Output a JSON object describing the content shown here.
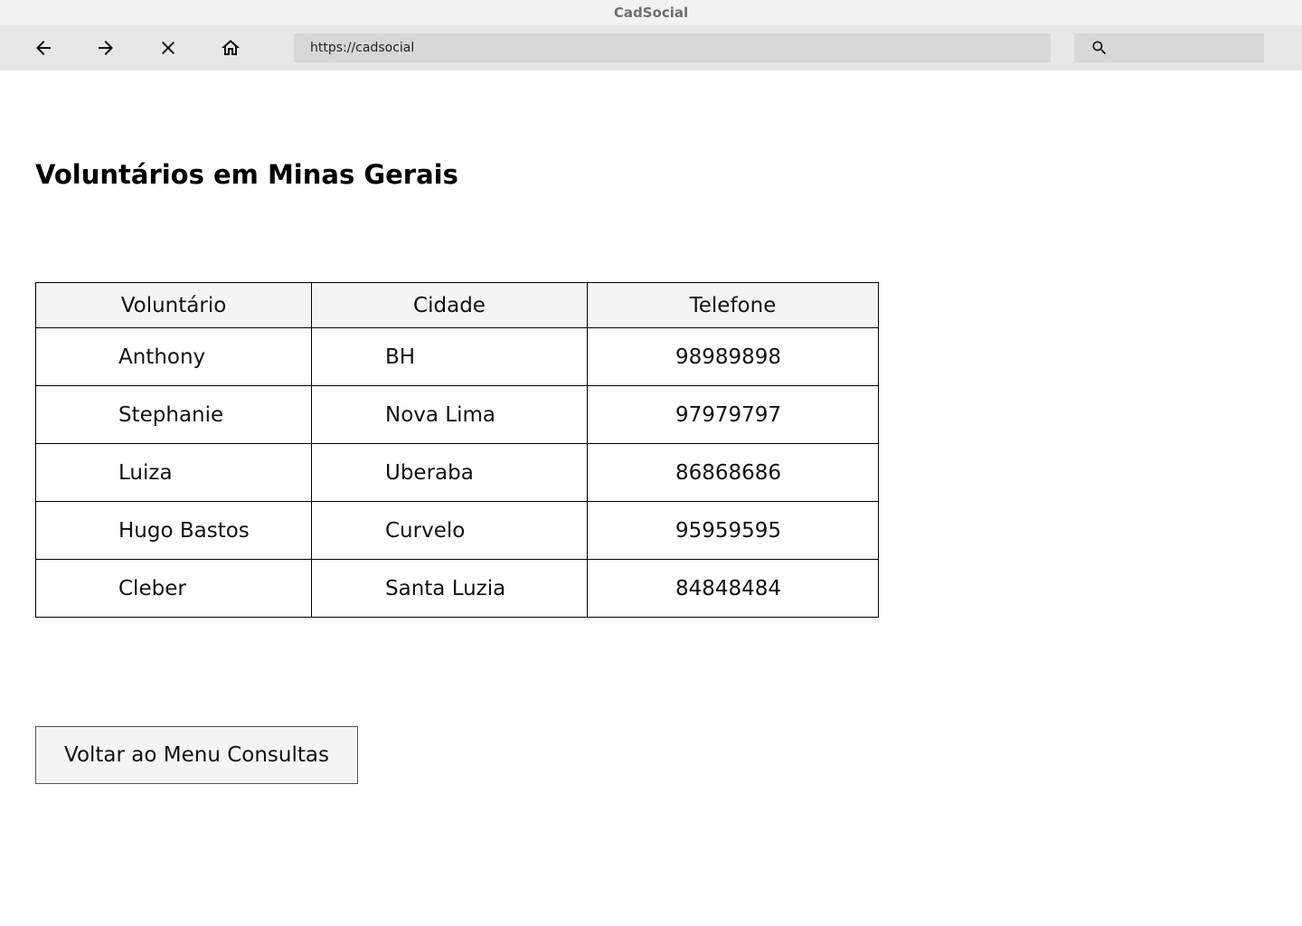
{
  "window": {
    "title": "CadSocial"
  },
  "toolbar": {
    "url": "https://cadsocial",
    "search_value": "",
    "icons": [
      "arrow-back-icon",
      "arrow-forward-icon",
      "close-icon",
      "home-icon",
      "search-icon"
    ]
  },
  "page": {
    "title": "Voluntários em Minas Gerais",
    "table": {
      "headers": [
        "Voluntário",
        "Cidade",
        "Telefone"
      ],
      "rows": [
        [
          "Anthony",
          "BH",
          "98989898"
        ],
        [
          "Stephanie",
          "Nova Lima",
          "97979797"
        ],
        [
          "Luiza",
          "Uberaba",
          "86868686"
        ],
        [
          "Hugo Bastos",
          "Curvelo",
          "95959595"
        ],
        [
          "Cleber",
          "Santa Luzia",
          "84848484"
        ]
      ]
    },
    "back_button_label": "Voltar ao Menu Consultas"
  },
  "colors": {
    "titlebar_bg": "#f2f2f2",
    "toolbar_bg": "#e6e6e6",
    "field_bg": "#d7d7d7",
    "header_bg": "#f4f4f4"
  }
}
